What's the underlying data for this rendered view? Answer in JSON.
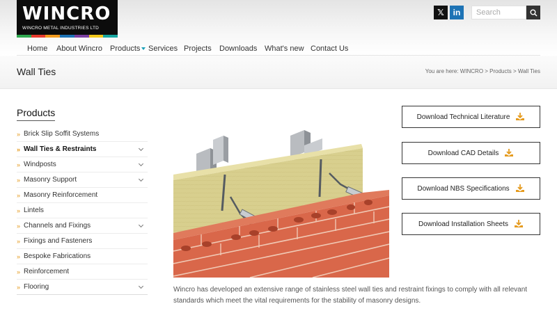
{
  "brand": {
    "name": "WINCRO",
    "tagline": "WINCRO METAL INDUSTRIES LTD",
    "stripe_colors": [
      "#2fa84f",
      "#e63b2e",
      "#f39c1f",
      "#1d73b5",
      "#7b3fa0",
      "#f2c81b",
      "#16a6a0"
    ]
  },
  "social": {
    "x_label": "𝕏",
    "linkedin_label": "in"
  },
  "search": {
    "placeholder": "Search"
  },
  "nav": {
    "items": [
      {
        "label": "Home"
      },
      {
        "label": "About Wincro"
      },
      {
        "label": "Products"
      },
      {
        "label": "Services"
      },
      {
        "label": "Projects"
      },
      {
        "label": "Downloads"
      },
      {
        "label": "What's new"
      },
      {
        "label": "Contact Us"
      }
    ]
  },
  "page": {
    "title": "Wall Ties",
    "breadcrumb": "You are here: WINCRO > Products > Wall Ties"
  },
  "sidebar": {
    "title": "Products",
    "items": [
      {
        "label": "Brick Slip Soffit Systems"
      },
      {
        "label": "Wall Ties & Restraints"
      },
      {
        "label": "Windposts"
      },
      {
        "label": "Masonry Support"
      },
      {
        "label": "Masonry Reinforcement"
      },
      {
        "label": "Lintels"
      },
      {
        "label": "Channels and Fixings"
      },
      {
        "label": "Fixings and Fasteners"
      },
      {
        "label": "Bespoke Fabrications"
      },
      {
        "label": "Reinforcement"
      },
      {
        "label": "Flooring"
      }
    ],
    "bullet": "»"
  },
  "downloads": [
    {
      "label": "Download Technical Literature"
    },
    {
      "label": "Download CAD Details"
    },
    {
      "label": "Download NBS Specifications"
    },
    {
      "label": "Download Installation Sheets"
    }
  ],
  "content": {
    "intro": "Wincro has developed an extensive range of stainless steel wall ties and restraint fixings to comply with all relevant standards which meet the vital requirements for the stability of masonry designs."
  },
  "colors": {
    "accent_orange": "#e59b1f",
    "nav_arrow": "#1ba0b8",
    "linkedin": "#1d73b5",
    "brick": "#d9674a",
    "insulation": "#d8cf8e"
  }
}
